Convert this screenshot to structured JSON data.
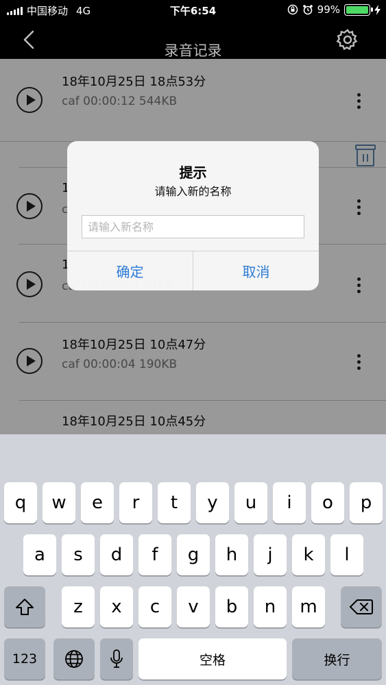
{
  "status_bar": {
    "carrier": "中国移动",
    "network": "4G",
    "time": "下午6:54",
    "battery_percent": "99%",
    "battery_level": 0.99,
    "icons": [
      "signal-icon",
      "orientation-lock-icon",
      "alarm-icon",
      "battery-icon",
      "charging-icon"
    ]
  },
  "nav": {
    "title": "录音记录",
    "icons": [
      "back-chevron-icon",
      "gear-icon"
    ]
  },
  "recordings": [
    {
      "title": "18年10月25日 18点53分",
      "meta": "caf 00:00:12 544KB"
    },
    {
      "title": "1",
      "meta": "c"
    },
    {
      "title": "1",
      "meta": "caf 00:00:0 3 04KB"
    },
    {
      "title": "18年10月25日 10点47分",
      "meta": "caf 00:00:04 190KB"
    },
    {
      "title": "18年10月25日 10点45分",
      "meta": ""
    }
  ],
  "alert": {
    "title": "提示",
    "message": "请输入新的名称",
    "input_placeholder": "请输入新名称",
    "input_value": "",
    "confirm_label": "确定",
    "cancel_label": "取消",
    "button_color": "#2d7bd6"
  },
  "keyboard": {
    "row1": [
      "q",
      "w",
      "e",
      "r",
      "t",
      "y",
      "u",
      "i",
      "o",
      "p"
    ],
    "row2": [
      "a",
      "s",
      "d",
      "f",
      "g",
      "h",
      "j",
      "k",
      "l"
    ],
    "row3": [
      "z",
      "x",
      "c",
      "v",
      "b",
      "n",
      "m"
    ],
    "numbers_label": "123",
    "space_label": "空格",
    "return_label": "换行",
    "icons": [
      "shift-icon",
      "delete-icon",
      "globe-icon",
      "microphone-icon"
    ]
  }
}
